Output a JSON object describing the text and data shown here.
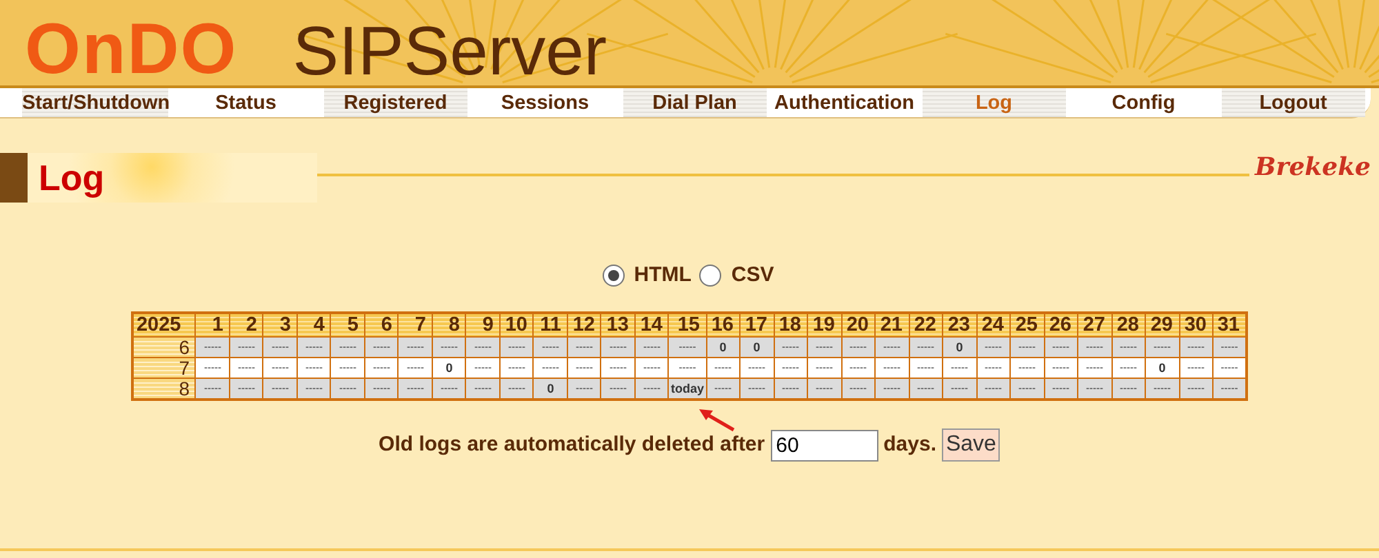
{
  "header": {
    "logo_brand": "OnDO",
    "logo_product": "SIPServer"
  },
  "nav": [
    {
      "label": "Start/Shutdown",
      "selected": false
    },
    {
      "label": "Status",
      "selected": false
    },
    {
      "label": "Registered",
      "selected": false
    },
    {
      "label": "Sessions",
      "selected": false
    },
    {
      "label": "Dial Plan",
      "selected": false
    },
    {
      "label": "Authentication",
      "selected": false
    },
    {
      "label": "Log",
      "selected": true
    },
    {
      "label": "Config",
      "selected": false
    },
    {
      "label": "Logout",
      "selected": false
    }
  ],
  "page_title": "Log",
  "vendor_logo": "Brekeke",
  "format_options": [
    {
      "label": "HTML",
      "selected": true
    },
    {
      "label": "CSV",
      "selected": false
    }
  ],
  "calendar": {
    "year": "2025",
    "days": [
      "1",
      "2",
      "3",
      "4",
      "5",
      "6",
      "7",
      "8",
      "9",
      "10",
      "11",
      "12",
      "13",
      "14",
      "15",
      "16",
      "17",
      "18",
      "19",
      "20",
      "21",
      "22",
      "23",
      "24",
      "25",
      "26",
      "27",
      "28",
      "29",
      "30",
      "31"
    ],
    "rows": [
      {
        "month": "6",
        "cells": [
          "-----",
          "-----",
          "-----",
          "-----",
          "-----",
          "-----",
          "-----",
          "-----",
          "-----",
          "-----",
          "-----",
          "-----",
          "-----",
          "-----",
          "-----",
          "0",
          "0",
          "-----",
          "-----",
          "-----",
          "-----",
          "-----",
          "0",
          "-----",
          "-----",
          "-----",
          "-----",
          "-----",
          "-----",
          "-----",
          "-----"
        ]
      },
      {
        "month": "7",
        "cells": [
          "-----",
          "-----",
          "-----",
          "-----",
          "-----",
          "-----",
          "-----",
          "0",
          "-----",
          "-----",
          "-----",
          "-----",
          "-----",
          "-----",
          "-----",
          "-----",
          "-----",
          "-----",
          "-----",
          "-----",
          "-----",
          "-----",
          "-----",
          "-----",
          "-----",
          "-----",
          "-----",
          "-----",
          "0",
          "-----",
          "-----"
        ]
      },
      {
        "month": "8",
        "cells": [
          "-----",
          "-----",
          "-----",
          "-----",
          "-----",
          "-----",
          "-----",
          "-----",
          "-----",
          "-----",
          "0",
          "-----",
          "-----",
          "-----",
          "today",
          "-----",
          "-----",
          "-----",
          "-----",
          "-----",
          "-----",
          "-----",
          "-----",
          "-----",
          "-----",
          "-----",
          "-----",
          "-----",
          "-----",
          "-----",
          "-----"
        ]
      }
    ]
  },
  "retention": {
    "label": "Old logs are automatically deleted after",
    "value": "60",
    "unit": "days.",
    "button": "Save"
  }
}
